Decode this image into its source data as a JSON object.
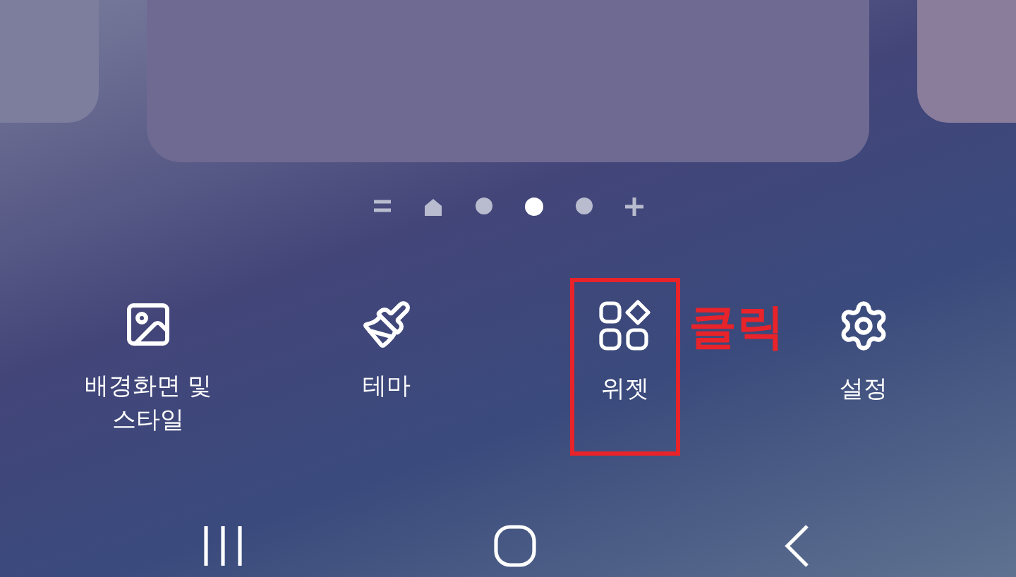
{
  "page_indicators": [
    {
      "kind": "menu",
      "selected": false
    },
    {
      "kind": "home",
      "selected": false
    },
    {
      "kind": "dot",
      "selected": false
    },
    {
      "kind": "dot",
      "selected": true
    },
    {
      "kind": "dot",
      "selected": false
    },
    {
      "kind": "add",
      "selected": false
    }
  ],
  "edit_menu": [
    {
      "kind": "wallpaper",
      "label": "배경화면 및 스타일",
      "highlighted": false
    },
    {
      "kind": "themes",
      "label": "테마",
      "highlighted": false
    },
    {
      "kind": "widgets",
      "label": "위젯",
      "highlighted": true
    },
    {
      "kind": "settings",
      "label": "설정",
      "highlighted": false
    }
  ],
  "annotation": {
    "text": "클릭"
  },
  "nav_bar": [
    {
      "kind": "recents"
    },
    {
      "kind": "home"
    },
    {
      "kind": "back"
    }
  ]
}
